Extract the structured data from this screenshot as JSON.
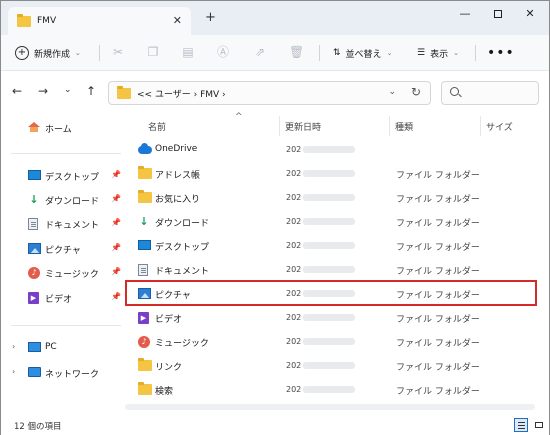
{
  "window": {
    "tab_title": "FMV",
    "tab_close": "✕",
    "new_tab": "+",
    "minimize": "—",
    "close": "✕"
  },
  "toolbar": {
    "new_label": "新規作成",
    "new_plus": "+",
    "chevron": "⌄",
    "sort_label": "並べ替え",
    "view_label": "表示",
    "more": "•••",
    "disabled_icons": [
      "cut-icon",
      "copy-icon",
      "paste-icon",
      "rename-icon",
      "share-icon",
      "delete-icon"
    ]
  },
  "nav": {
    "back": "←",
    "forward": "→",
    "recent": "⌄",
    "up": "↑",
    "breadcrumb": "<< ユーザー › FMV ›",
    "dropdown": "⌄",
    "refresh": "↻"
  },
  "sidebar": {
    "home": "ホーム",
    "pinned": [
      {
        "label": "デスクトップ",
        "icon": "desktop-icon"
      },
      {
        "label": "ダウンロード",
        "icon": "download-icon"
      },
      {
        "label": "ドキュメント",
        "icon": "documents-icon"
      },
      {
        "label": "ピクチャ",
        "icon": "pictures-icon"
      },
      {
        "label": "ミュージック",
        "icon": "music-icon"
      },
      {
        "label": "ビデオ",
        "icon": "video-icon"
      }
    ],
    "pin_glyph": "📌",
    "pc": "PC",
    "network": "ネットワーク",
    "expander": "›"
  },
  "columns": {
    "name": "名前",
    "modified": "更新日時",
    "type": "種類",
    "size": "サイズ",
    "sort_arrow": "^"
  },
  "files": [
    {
      "name": "OneDrive",
      "date": "202",
      "type": "",
      "icon": "onedrive-icon"
    },
    {
      "name": "アドレス帳",
      "date": "202",
      "type": "ファイル フォルダー",
      "icon": "folder-icon"
    },
    {
      "name": "お気に入り",
      "date": "202",
      "type": "ファイル フォルダー",
      "icon": "folder-icon"
    },
    {
      "name": "ダウンロード",
      "date": "202",
      "type": "ファイル フォルダー",
      "icon": "download-icon"
    },
    {
      "name": "デスクトップ",
      "date": "202",
      "type": "ファイル フォルダー",
      "icon": "desktop-icon"
    },
    {
      "name": "ドキュメント",
      "date": "202",
      "type": "ファイル フォルダー",
      "icon": "documents-icon"
    },
    {
      "name": "ピクチャ",
      "date": "202",
      "type": "ファイル フォルダー",
      "icon": "pictures-icon"
    },
    {
      "name": "ビデオ",
      "date": "202",
      "type": "ファイル フォルダー",
      "icon": "video-icon"
    },
    {
      "name": "ミュージック",
      "date": "202",
      "type": "ファイル フォルダー",
      "icon": "music-icon"
    },
    {
      "name": "リンク",
      "date": "202",
      "type": "ファイル フォルダー",
      "icon": "folder-icon"
    },
    {
      "name": "検索",
      "date": "202",
      "type": "ファイル フォルダー",
      "icon": "folder-icon"
    }
  ],
  "status": {
    "count": "12 個の項目"
  },
  "colors": {
    "highlight": "#d62a2a",
    "folder": "#f4c443",
    "accent": "#1b6ec2"
  }
}
